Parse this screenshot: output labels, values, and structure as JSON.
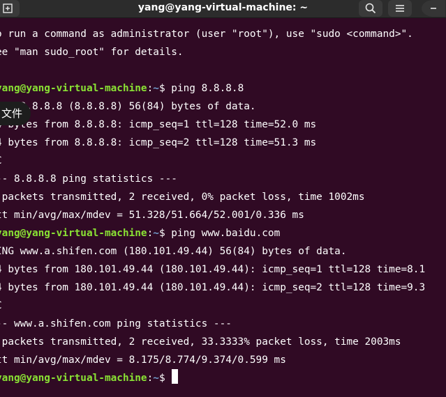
{
  "window": {
    "title": "yang@yang-virtual-machine: ~",
    "icons": {
      "new_tab": "new-tab-icon",
      "search": "search-icon",
      "menu": "hamburger-menu-icon",
      "minimize": "minimize-icon"
    }
  },
  "ime_popup": {
    "label": "文件"
  },
  "prompt": {
    "user": "yang@yang-virtual-machine",
    "sep": ":",
    "path": "~",
    "dollar": "$ "
  },
  "terminal": {
    "lines": [
      {
        "type": "text",
        "text": "o run a command as administrator (user \"root\"), use \"sudo <command>\"."
      },
      {
        "type": "text",
        "text": "ee \"man sudo_root\" for details."
      },
      {
        "type": "text",
        "text": ""
      },
      {
        "type": "prompt",
        "command": "ping 8.8.8.8"
      },
      {
        "type": "text",
        "text": "ING 8.8.8.8 (8.8.8.8) 56(84) bytes of data."
      },
      {
        "type": "text",
        "text": "4 bytes from 8.8.8.8: icmp_seq=1 ttl=128 time=52.0 ms"
      },
      {
        "type": "text",
        "text": "4 bytes from 8.8.8.8: icmp_seq=2 ttl=128 time=51.3 ms"
      },
      {
        "type": "text",
        "text": "C"
      },
      {
        "type": "text",
        "text": "-- 8.8.8.8 ping statistics ---"
      },
      {
        "type": "text",
        "text": " packets transmitted, 2 received, 0% packet loss, time 1002ms"
      },
      {
        "type": "text",
        "text": "tt min/avg/max/mdev = 51.328/51.664/52.001/0.336 ms"
      },
      {
        "type": "prompt",
        "command": "ping www.baidu.com"
      },
      {
        "type": "text",
        "text": "ING www.a.shifen.com (180.101.49.44) 56(84) bytes of data."
      },
      {
        "type": "text",
        "text": "4 bytes from 180.101.49.44 (180.101.49.44): icmp_seq=1 ttl=128 time=8.1"
      },
      {
        "type": "text",
        "text": "4 bytes from 180.101.49.44 (180.101.49.44): icmp_seq=2 ttl=128 time=9.3"
      },
      {
        "type": "text",
        "text": "C"
      },
      {
        "type": "text",
        "text": "-- www.a.shifen.com ping statistics ---"
      },
      {
        "type": "text",
        "text": " packets transmitted, 2 received, 33.3333% packet loss, time 2003ms"
      },
      {
        "type": "text",
        "text": "tt min/avg/max/mdev = 8.175/8.774/9.374/0.599 ms"
      },
      {
        "type": "prompt",
        "command": "",
        "cursor": true
      }
    ]
  },
  "colors": {
    "background": "#300a24",
    "prompt_user": "#8ae234",
    "prompt_path": "#729fcf",
    "text": "#ffffff",
    "titlebar": "#2c2c2c"
  }
}
